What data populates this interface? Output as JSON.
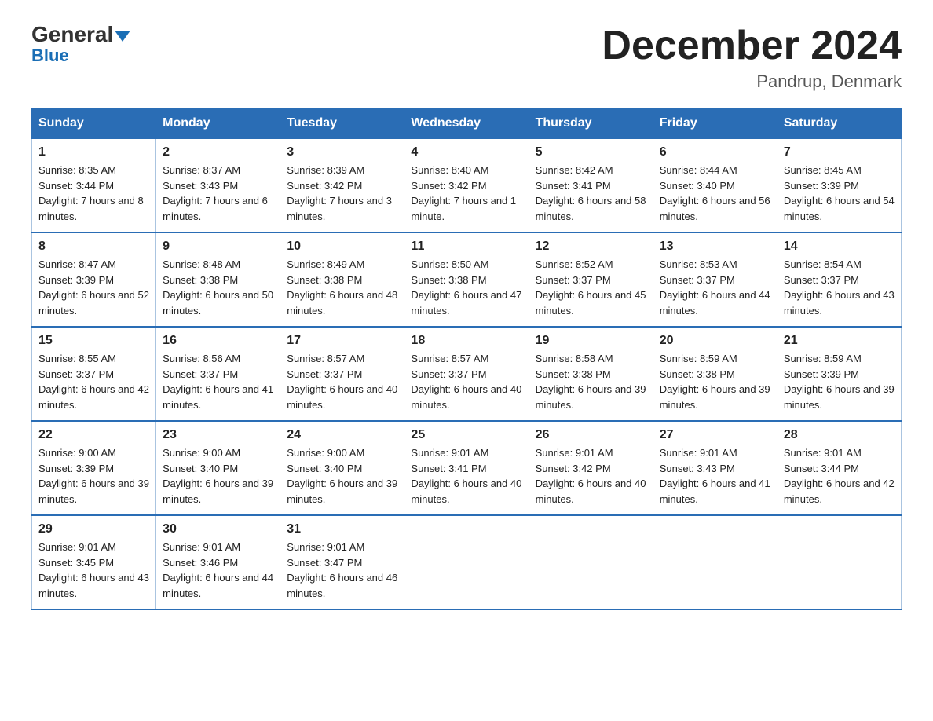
{
  "header": {
    "logo_top": "General",
    "logo_bottom": "Blue",
    "month_title": "December 2024",
    "location": "Pandrup, Denmark"
  },
  "days_of_week": [
    "Sunday",
    "Monday",
    "Tuesday",
    "Wednesday",
    "Thursday",
    "Friday",
    "Saturday"
  ],
  "weeks": [
    [
      {
        "day": "1",
        "sunrise": "8:35 AM",
        "sunset": "3:44 PM",
        "daylight": "7 hours and 8 minutes."
      },
      {
        "day": "2",
        "sunrise": "8:37 AM",
        "sunset": "3:43 PM",
        "daylight": "7 hours and 6 minutes."
      },
      {
        "day": "3",
        "sunrise": "8:39 AM",
        "sunset": "3:42 PM",
        "daylight": "7 hours and 3 minutes."
      },
      {
        "day": "4",
        "sunrise": "8:40 AM",
        "sunset": "3:42 PM",
        "daylight": "7 hours and 1 minute."
      },
      {
        "day": "5",
        "sunrise": "8:42 AM",
        "sunset": "3:41 PM",
        "daylight": "6 hours and 58 minutes."
      },
      {
        "day": "6",
        "sunrise": "8:44 AM",
        "sunset": "3:40 PM",
        "daylight": "6 hours and 56 minutes."
      },
      {
        "day": "7",
        "sunrise": "8:45 AM",
        "sunset": "3:39 PM",
        "daylight": "6 hours and 54 minutes."
      }
    ],
    [
      {
        "day": "8",
        "sunrise": "8:47 AM",
        "sunset": "3:39 PM",
        "daylight": "6 hours and 52 minutes."
      },
      {
        "day": "9",
        "sunrise": "8:48 AM",
        "sunset": "3:38 PM",
        "daylight": "6 hours and 50 minutes."
      },
      {
        "day": "10",
        "sunrise": "8:49 AM",
        "sunset": "3:38 PM",
        "daylight": "6 hours and 48 minutes."
      },
      {
        "day": "11",
        "sunrise": "8:50 AM",
        "sunset": "3:38 PM",
        "daylight": "6 hours and 47 minutes."
      },
      {
        "day": "12",
        "sunrise": "8:52 AM",
        "sunset": "3:37 PM",
        "daylight": "6 hours and 45 minutes."
      },
      {
        "day": "13",
        "sunrise": "8:53 AM",
        "sunset": "3:37 PM",
        "daylight": "6 hours and 44 minutes."
      },
      {
        "day": "14",
        "sunrise": "8:54 AM",
        "sunset": "3:37 PM",
        "daylight": "6 hours and 43 minutes."
      }
    ],
    [
      {
        "day": "15",
        "sunrise": "8:55 AM",
        "sunset": "3:37 PM",
        "daylight": "6 hours and 42 minutes."
      },
      {
        "day": "16",
        "sunrise": "8:56 AM",
        "sunset": "3:37 PM",
        "daylight": "6 hours and 41 minutes."
      },
      {
        "day": "17",
        "sunrise": "8:57 AM",
        "sunset": "3:37 PM",
        "daylight": "6 hours and 40 minutes."
      },
      {
        "day": "18",
        "sunrise": "8:57 AM",
        "sunset": "3:37 PM",
        "daylight": "6 hours and 40 minutes."
      },
      {
        "day": "19",
        "sunrise": "8:58 AM",
        "sunset": "3:38 PM",
        "daylight": "6 hours and 39 minutes."
      },
      {
        "day": "20",
        "sunrise": "8:59 AM",
        "sunset": "3:38 PM",
        "daylight": "6 hours and 39 minutes."
      },
      {
        "day": "21",
        "sunrise": "8:59 AM",
        "sunset": "3:39 PM",
        "daylight": "6 hours and 39 minutes."
      }
    ],
    [
      {
        "day": "22",
        "sunrise": "9:00 AM",
        "sunset": "3:39 PM",
        "daylight": "6 hours and 39 minutes."
      },
      {
        "day": "23",
        "sunrise": "9:00 AM",
        "sunset": "3:40 PM",
        "daylight": "6 hours and 39 minutes."
      },
      {
        "day": "24",
        "sunrise": "9:00 AM",
        "sunset": "3:40 PM",
        "daylight": "6 hours and 39 minutes."
      },
      {
        "day": "25",
        "sunrise": "9:01 AM",
        "sunset": "3:41 PM",
        "daylight": "6 hours and 40 minutes."
      },
      {
        "day": "26",
        "sunrise": "9:01 AM",
        "sunset": "3:42 PM",
        "daylight": "6 hours and 40 minutes."
      },
      {
        "day": "27",
        "sunrise": "9:01 AM",
        "sunset": "3:43 PM",
        "daylight": "6 hours and 41 minutes."
      },
      {
        "day": "28",
        "sunrise": "9:01 AM",
        "sunset": "3:44 PM",
        "daylight": "6 hours and 42 minutes."
      }
    ],
    [
      {
        "day": "29",
        "sunrise": "9:01 AM",
        "sunset": "3:45 PM",
        "daylight": "6 hours and 43 minutes."
      },
      {
        "day": "30",
        "sunrise": "9:01 AM",
        "sunset": "3:46 PM",
        "daylight": "6 hours and 44 minutes."
      },
      {
        "day": "31",
        "sunrise": "9:01 AM",
        "sunset": "3:47 PM",
        "daylight": "6 hours and 46 minutes."
      },
      null,
      null,
      null,
      null
    ]
  ]
}
